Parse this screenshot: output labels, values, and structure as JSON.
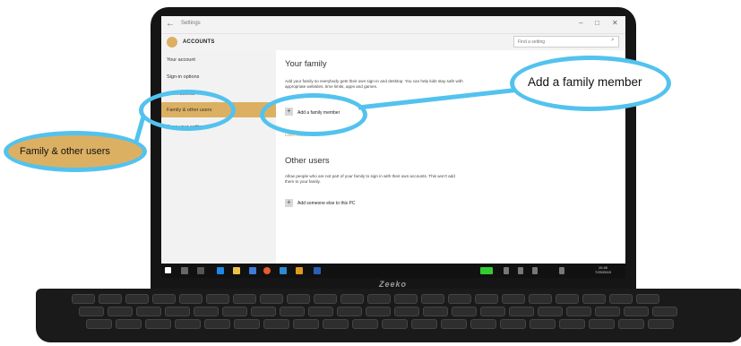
{
  "window": {
    "title": "Settings",
    "section": "ACCOUNTS",
    "search_placeholder": "Find a setting"
  },
  "sidebar": {
    "items": [
      {
        "label": "Your account"
      },
      {
        "label": "Sign-in options"
      },
      {
        "label": "Work access"
      },
      {
        "label": "Family & other users"
      },
      {
        "label": "Sync your settings"
      }
    ]
  },
  "content": {
    "family_heading": "Your family",
    "family_desc": "Add your family so everybody gets their own sign-in and desktop. You can help kids stay safe with appropriate websites, time limits, apps and games.",
    "add_family_label": "Add a family member",
    "learn_more": "Learn more",
    "other_heading": "Other users",
    "other_desc": "Allow people who are not part of your family to sign in with their own accounts. This won't add them to your family.",
    "add_other_label": "Add someone else to this PC"
  },
  "taskbar": {
    "time": "10:45",
    "date": "7/29/2015"
  },
  "brand": "Zeeko",
  "callouts": {
    "add_member": "Add a family member",
    "family_users": "Family & other users"
  },
  "colors": {
    "accent": "#dcb062",
    "highlight": "#53c2ee"
  }
}
